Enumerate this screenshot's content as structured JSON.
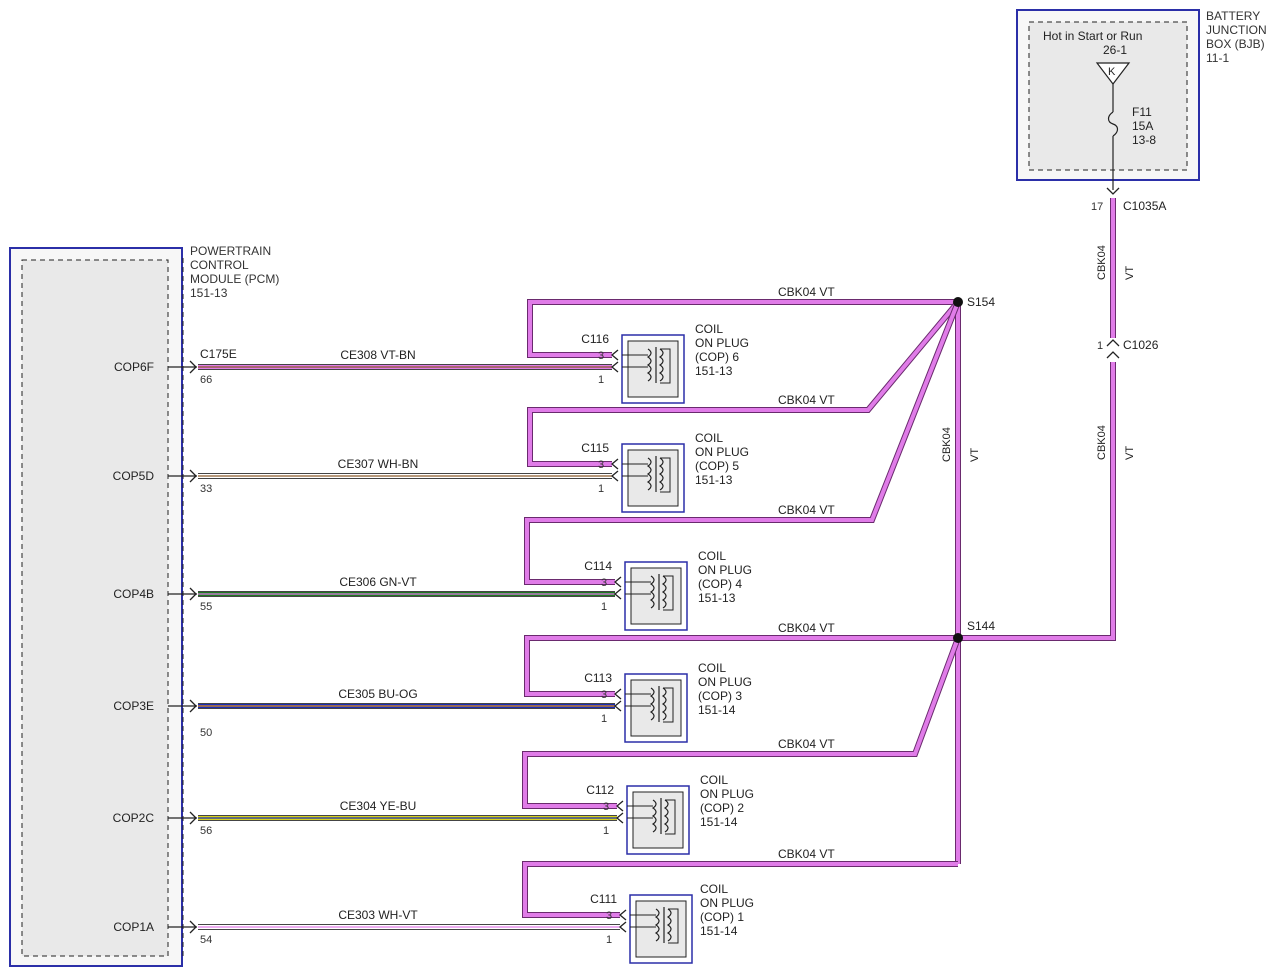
{
  "pcm": {
    "name_lines": [
      "POWERTRAIN",
      "CONTROL",
      "MODULE (PCM)"
    ],
    "ref": "151-13",
    "connector": "C175E",
    "pins": [
      "COP6F",
      "COP5D",
      "COP4B",
      "COP3E",
      "COP2C",
      "COP1A"
    ]
  },
  "bjb": {
    "name_lines": [
      "BATTERY",
      "JUNCTION",
      "BOX (BJB)"
    ],
    "ref": "11-1",
    "hot_label": "Hot in Start or Run",
    "hot_ref": "26-1",
    "relay_symbol": "K",
    "fuse_name": "F11",
    "fuse_rating": "15A",
    "fuse_ref": "13-8"
  },
  "connectors": {
    "c1035a": {
      "name": "C1035A",
      "pin": "17"
    },
    "c1026": {
      "name": "C1026",
      "pin": "1"
    }
  },
  "splices": {
    "s154": "S154",
    "s144": "S144"
  },
  "feed_wire": {
    "circuit": "CBK04",
    "color": "VT"
  },
  "colors": {
    "vt": "#e07ce8",
    "vt_dark": "#6a2a6e",
    "module_border": "#2b2fa8",
    "gn": "#1f7a22",
    "bu": "#1a2fb8",
    "ye": "#d9d21a",
    "wh": "#ffffff",
    "bn": "#8a5a2a",
    "og": "#e08a1a"
  },
  "coils": [
    {
      "connector": "C116",
      "pin_top": "3",
      "pin_bottom": "1",
      "name_lines": [
        "COIL",
        "ON PLUG",
        "(COP) 6"
      ],
      "ref": "151-13",
      "feed_label": "CBK04  VT",
      "signal_circuit": "CE308  VT-BN",
      "pcm_pin": "66"
    },
    {
      "connector": "C115",
      "pin_top": "3",
      "pin_bottom": "1",
      "name_lines": [
        "COIL",
        "ON PLUG",
        "(COP) 5"
      ],
      "ref": "151-13",
      "feed_label": "CBK04  VT",
      "signal_circuit": "CE307  WH-BN",
      "pcm_pin": "33"
    },
    {
      "connector": "C114",
      "pin_top": "3",
      "pin_bottom": "1",
      "name_lines": [
        "COIL",
        "ON PLUG",
        "(COP) 4"
      ],
      "ref": "151-13",
      "feed_label": "CBK04  VT",
      "signal_circuit": "CE306  GN-VT",
      "pcm_pin": "55"
    },
    {
      "connector": "C113",
      "pin_top": "3",
      "pin_bottom": "1",
      "name_lines": [
        "COIL",
        "ON PLUG",
        "(COP) 3"
      ],
      "ref": "151-14",
      "feed_label": "CBK04  VT",
      "signal_circuit": "CE305  BU-OG",
      "pcm_pin": "50"
    },
    {
      "connector": "C112",
      "pin_top": "3",
      "pin_bottom": "1",
      "name_lines": [
        "COIL",
        "ON PLUG",
        "(COP) 2"
      ],
      "ref": "151-14",
      "feed_label": "CBK04  VT",
      "signal_circuit": "CE304  YE-BU",
      "pcm_pin": "56"
    },
    {
      "connector": "C111",
      "pin_top": "3",
      "pin_bottom": "1",
      "name_lines": [
        "COIL",
        "ON PLUG",
        "(COP) 1"
      ],
      "ref": "151-14",
      "feed_label": "CBK04  VT",
      "signal_circuit": "CE303  WH-VT",
      "pcm_pin": "54"
    }
  ]
}
